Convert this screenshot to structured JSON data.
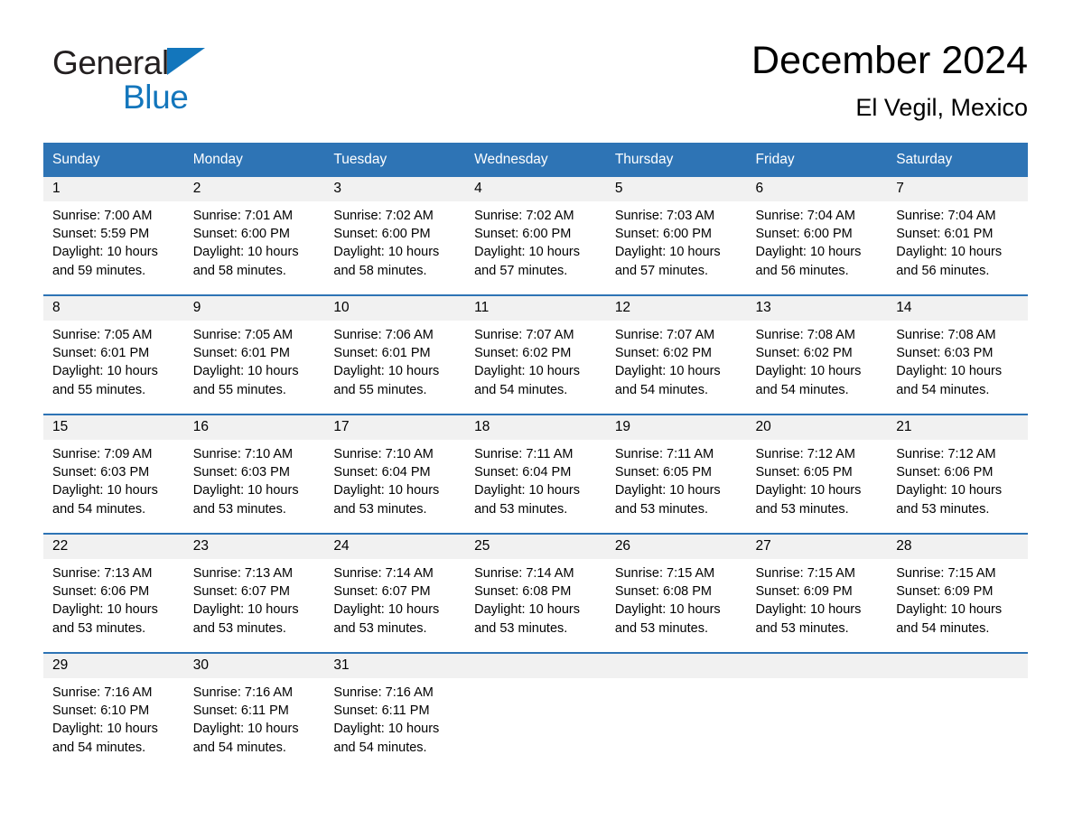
{
  "brand": {
    "name_part1": "General",
    "name_part2": "Blue",
    "flag_icon": "triangle-flag-icon",
    "accent_color": "#1376bc"
  },
  "header": {
    "title": "December 2024",
    "subtitle": "El Vegil, Mexico"
  },
  "colors": {
    "header_blue": "#2e74b5",
    "row_separator_blue": "#2e74b5",
    "daynum_band": "#f1f1f1",
    "text": "#000000",
    "header_text": "#ffffff"
  },
  "weekday_headers": [
    "Sunday",
    "Monday",
    "Tuesday",
    "Wednesday",
    "Thursday",
    "Friday",
    "Saturday"
  ],
  "weeks": [
    [
      {
        "day": "1",
        "sunrise": "Sunrise: 7:00 AM",
        "sunset": "Sunset: 5:59 PM",
        "daylight_line1": "Daylight: 10 hours",
        "daylight_line2": "and 59 minutes."
      },
      {
        "day": "2",
        "sunrise": "Sunrise: 7:01 AM",
        "sunset": "Sunset: 6:00 PM",
        "daylight_line1": "Daylight: 10 hours",
        "daylight_line2": "and 58 minutes."
      },
      {
        "day": "3",
        "sunrise": "Sunrise: 7:02 AM",
        "sunset": "Sunset: 6:00 PM",
        "daylight_line1": "Daylight: 10 hours",
        "daylight_line2": "and 58 minutes."
      },
      {
        "day": "4",
        "sunrise": "Sunrise: 7:02 AM",
        "sunset": "Sunset: 6:00 PM",
        "daylight_line1": "Daylight: 10 hours",
        "daylight_line2": "and 57 minutes."
      },
      {
        "day": "5",
        "sunrise": "Sunrise: 7:03 AM",
        "sunset": "Sunset: 6:00 PM",
        "daylight_line1": "Daylight: 10 hours",
        "daylight_line2": "and 57 minutes."
      },
      {
        "day": "6",
        "sunrise": "Sunrise: 7:04 AM",
        "sunset": "Sunset: 6:00 PM",
        "daylight_line1": "Daylight: 10 hours",
        "daylight_line2": "and 56 minutes."
      },
      {
        "day": "7",
        "sunrise": "Sunrise: 7:04 AM",
        "sunset": "Sunset: 6:01 PM",
        "daylight_line1": "Daylight: 10 hours",
        "daylight_line2": "and 56 minutes."
      }
    ],
    [
      {
        "day": "8",
        "sunrise": "Sunrise: 7:05 AM",
        "sunset": "Sunset: 6:01 PM",
        "daylight_line1": "Daylight: 10 hours",
        "daylight_line2": "and 55 minutes."
      },
      {
        "day": "9",
        "sunrise": "Sunrise: 7:05 AM",
        "sunset": "Sunset: 6:01 PM",
        "daylight_line1": "Daylight: 10 hours",
        "daylight_line2": "and 55 minutes."
      },
      {
        "day": "10",
        "sunrise": "Sunrise: 7:06 AM",
        "sunset": "Sunset: 6:01 PM",
        "daylight_line1": "Daylight: 10 hours",
        "daylight_line2": "and 55 minutes."
      },
      {
        "day": "11",
        "sunrise": "Sunrise: 7:07 AM",
        "sunset": "Sunset: 6:02 PM",
        "daylight_line1": "Daylight: 10 hours",
        "daylight_line2": "and 54 minutes."
      },
      {
        "day": "12",
        "sunrise": "Sunrise: 7:07 AM",
        "sunset": "Sunset: 6:02 PM",
        "daylight_line1": "Daylight: 10 hours",
        "daylight_line2": "and 54 minutes."
      },
      {
        "day": "13",
        "sunrise": "Sunrise: 7:08 AM",
        "sunset": "Sunset: 6:02 PM",
        "daylight_line1": "Daylight: 10 hours",
        "daylight_line2": "and 54 minutes."
      },
      {
        "day": "14",
        "sunrise": "Sunrise: 7:08 AM",
        "sunset": "Sunset: 6:03 PM",
        "daylight_line1": "Daylight: 10 hours",
        "daylight_line2": "and 54 minutes."
      }
    ],
    [
      {
        "day": "15",
        "sunrise": "Sunrise: 7:09 AM",
        "sunset": "Sunset: 6:03 PM",
        "daylight_line1": "Daylight: 10 hours",
        "daylight_line2": "and 54 minutes."
      },
      {
        "day": "16",
        "sunrise": "Sunrise: 7:10 AM",
        "sunset": "Sunset: 6:03 PM",
        "daylight_line1": "Daylight: 10 hours",
        "daylight_line2": "and 53 minutes."
      },
      {
        "day": "17",
        "sunrise": "Sunrise: 7:10 AM",
        "sunset": "Sunset: 6:04 PM",
        "daylight_line1": "Daylight: 10 hours",
        "daylight_line2": "and 53 minutes."
      },
      {
        "day": "18",
        "sunrise": "Sunrise: 7:11 AM",
        "sunset": "Sunset: 6:04 PM",
        "daylight_line1": "Daylight: 10 hours",
        "daylight_line2": "and 53 minutes."
      },
      {
        "day": "19",
        "sunrise": "Sunrise: 7:11 AM",
        "sunset": "Sunset: 6:05 PM",
        "daylight_line1": "Daylight: 10 hours",
        "daylight_line2": "and 53 minutes."
      },
      {
        "day": "20",
        "sunrise": "Sunrise: 7:12 AM",
        "sunset": "Sunset: 6:05 PM",
        "daylight_line1": "Daylight: 10 hours",
        "daylight_line2": "and 53 minutes."
      },
      {
        "day": "21",
        "sunrise": "Sunrise: 7:12 AM",
        "sunset": "Sunset: 6:06 PM",
        "daylight_line1": "Daylight: 10 hours",
        "daylight_line2": "and 53 minutes."
      }
    ],
    [
      {
        "day": "22",
        "sunrise": "Sunrise: 7:13 AM",
        "sunset": "Sunset: 6:06 PM",
        "daylight_line1": "Daylight: 10 hours",
        "daylight_line2": "and 53 minutes."
      },
      {
        "day": "23",
        "sunrise": "Sunrise: 7:13 AM",
        "sunset": "Sunset: 6:07 PM",
        "daylight_line1": "Daylight: 10 hours",
        "daylight_line2": "and 53 minutes."
      },
      {
        "day": "24",
        "sunrise": "Sunrise: 7:14 AM",
        "sunset": "Sunset: 6:07 PM",
        "daylight_line1": "Daylight: 10 hours",
        "daylight_line2": "and 53 minutes."
      },
      {
        "day": "25",
        "sunrise": "Sunrise: 7:14 AM",
        "sunset": "Sunset: 6:08 PM",
        "daylight_line1": "Daylight: 10 hours",
        "daylight_line2": "and 53 minutes."
      },
      {
        "day": "26",
        "sunrise": "Sunrise: 7:15 AM",
        "sunset": "Sunset: 6:08 PM",
        "daylight_line1": "Daylight: 10 hours",
        "daylight_line2": "and 53 minutes."
      },
      {
        "day": "27",
        "sunrise": "Sunrise: 7:15 AM",
        "sunset": "Sunset: 6:09 PM",
        "daylight_line1": "Daylight: 10 hours",
        "daylight_line2": "and 53 minutes."
      },
      {
        "day": "28",
        "sunrise": "Sunrise: 7:15 AM",
        "sunset": "Sunset: 6:09 PM",
        "daylight_line1": "Daylight: 10 hours",
        "daylight_line2": "and 54 minutes."
      }
    ],
    [
      {
        "day": "29",
        "sunrise": "Sunrise: 7:16 AM",
        "sunset": "Sunset: 6:10 PM",
        "daylight_line1": "Daylight: 10 hours",
        "daylight_line2": "and 54 minutes."
      },
      {
        "day": "30",
        "sunrise": "Sunrise: 7:16 AM",
        "sunset": "Sunset: 6:11 PM",
        "daylight_line1": "Daylight: 10 hours",
        "daylight_line2": "and 54 minutes."
      },
      {
        "day": "31",
        "sunrise": "Sunrise: 7:16 AM",
        "sunset": "Sunset: 6:11 PM",
        "daylight_line1": "Daylight: 10 hours",
        "daylight_line2": "and 54 minutes."
      },
      {
        "day": "",
        "sunrise": "",
        "sunset": "",
        "daylight_line1": "",
        "daylight_line2": ""
      },
      {
        "day": "",
        "sunrise": "",
        "sunset": "",
        "daylight_line1": "",
        "daylight_line2": ""
      },
      {
        "day": "",
        "sunrise": "",
        "sunset": "",
        "daylight_line1": "",
        "daylight_line2": ""
      },
      {
        "day": "",
        "sunrise": "",
        "sunset": "",
        "daylight_line1": "",
        "daylight_line2": ""
      }
    ]
  ]
}
